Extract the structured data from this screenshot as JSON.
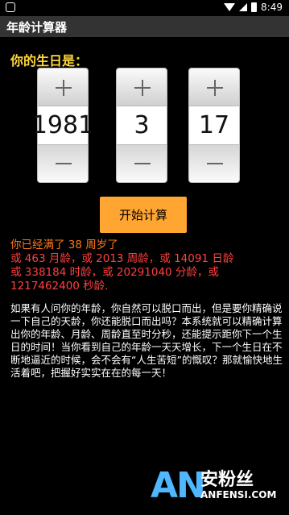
{
  "status_bar": {
    "time": "8:49"
  },
  "app": {
    "title": "年龄计算器"
  },
  "prompt": "你的生日是：",
  "pickers": [
    {
      "value": "1981"
    },
    {
      "value": "3"
    },
    {
      "value": "17"
    }
  ],
  "start_button": "开始计算",
  "result": {
    "line1": "你已经满了 38 周岁了",
    "line2": "或 463 月龄，或 2013 周龄，或 14091 日龄",
    "line3": "或 338184 时龄，或 20291040 分龄，或",
    "line4": "1217462400 秒龄."
  },
  "description": "如果有人问你的年龄，你自然可以脱口而出，但是要你精确说一下自己的天龄，你还能脱口而出吗？本系统就可以精确计算出你的年龄、月龄、周龄直至时分秒，还能提示距你下一个生日的时间！当你看到自己的年龄一天天增长，下一个生日在不断地逼近的时候，会不会有“人生苦短”的慨叹？那就愉快地生活着吧，把握好实实在在的每一天！",
  "watermark": {
    "mark": "AN",
    "cn": "安粉丝",
    "en": "ANFENSI.COM"
  },
  "colors": {
    "accent": "#ffa531",
    "prompt": "#ffd83b",
    "result_orange": "#ff7a1a",
    "result_red": "#ff4040",
    "titlebar": "#333333"
  }
}
